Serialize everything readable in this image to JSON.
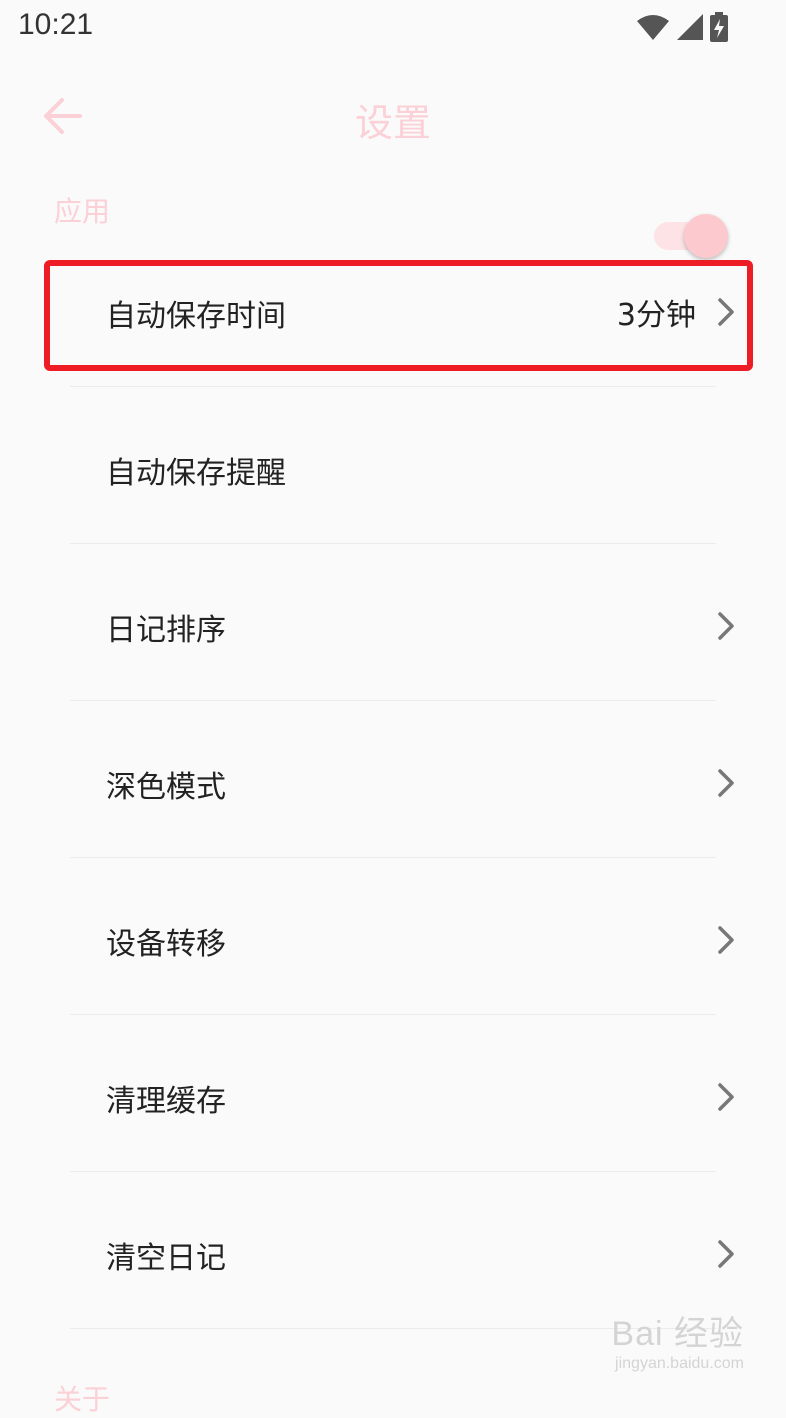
{
  "status_bar": {
    "time": "10:21",
    "icons": [
      "wifi-icon",
      "signal-icon",
      "battery-charging-icon"
    ]
  },
  "appbar": {
    "back_icon": "arrow-left-icon",
    "title": "设置"
  },
  "section": {
    "label": "应用"
  },
  "items": [
    {
      "label": "自动保存时间",
      "value": "3分钟",
      "control": "chevron"
    },
    {
      "label": "自动保存提醒",
      "control": "toggle",
      "toggle_on": true
    },
    {
      "label": "日记排序",
      "control": "chevron"
    },
    {
      "label": "深色模式",
      "control": "chevron"
    },
    {
      "label": "设备转移",
      "control": "chevron"
    },
    {
      "label": "清理缓存",
      "control": "chevron"
    },
    {
      "label": "清空日记",
      "control": "chevron"
    }
  ],
  "next_section": {
    "label": "关于"
  },
  "watermark": {
    "main": "Bai 经验",
    "sub": "jingyan.baidu.com"
  },
  "colors": {
    "accent": "#fbd0d6",
    "highlight": "#ee1c25",
    "background": "#fafafa"
  }
}
